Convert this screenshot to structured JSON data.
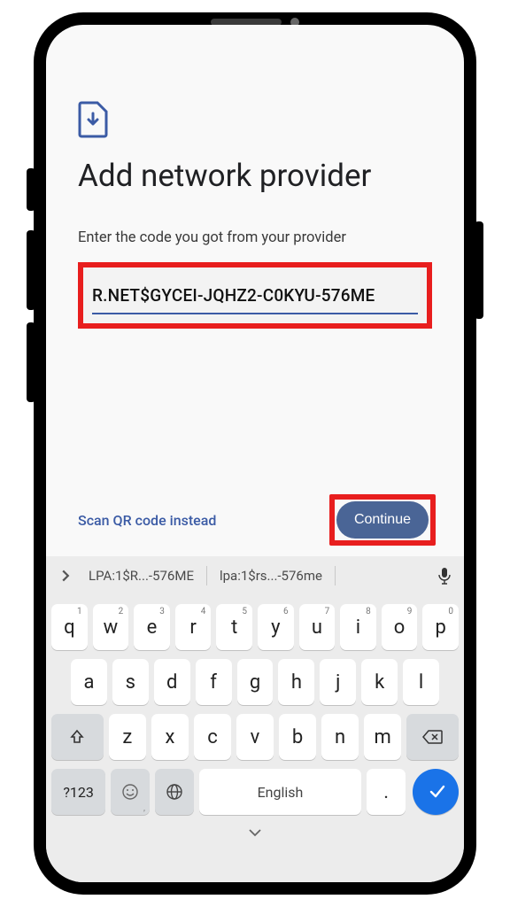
{
  "header": {
    "title": "Add network provider",
    "subtitle": "Enter the code you got from your provider"
  },
  "input": {
    "value": "R.NET$GYCEI-JQHZ2-C0KYU-576ME"
  },
  "actions": {
    "scan_link": "Scan QR code instead",
    "continue_label": "Continue"
  },
  "suggestions": {
    "item1": "LPA:1$R...-576ME",
    "item2": "lpa:1$rs...-576me"
  },
  "keyboard": {
    "row1": [
      "q",
      "w",
      "e",
      "r",
      "t",
      "y",
      "u",
      "i",
      "o",
      "p"
    ],
    "row1_sup": [
      "1",
      "2",
      "3",
      "4",
      "5",
      "6",
      "7",
      "8",
      "9",
      "0"
    ],
    "row2": [
      "a",
      "s",
      "d",
      "f",
      "g",
      "h",
      "j",
      "k",
      "l"
    ],
    "row3": [
      "z",
      "x",
      "c",
      "v",
      "b",
      "n",
      "m"
    ],
    "sym_label": "?123",
    "space_label": "English",
    "period_label": "."
  },
  "colors": {
    "highlight": "#e81e1e",
    "primary": "#4a6596",
    "enter": "#1a73e8"
  }
}
